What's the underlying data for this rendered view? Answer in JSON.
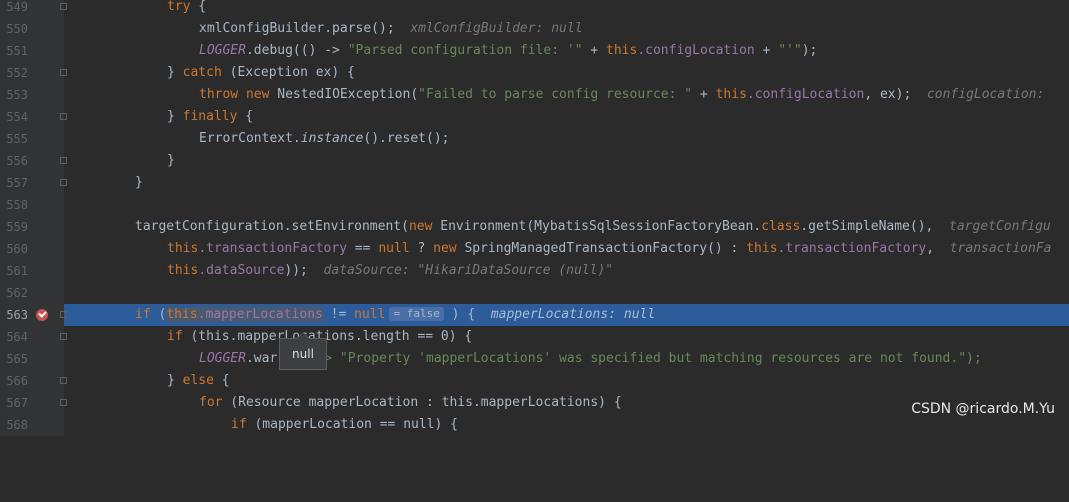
{
  "gutter": {
    "line_numbers": [
      "549",
      "550",
      "551",
      "552",
      "553",
      "554",
      "555",
      "556",
      "557",
      "558",
      "559",
      "560",
      "561",
      "562",
      "563",
      "564",
      "565",
      "566",
      "567",
      "568"
    ]
  },
  "code": {
    "l549": {
      "kw": "try",
      "rest": " {"
    },
    "l550": {
      "text": "xmlConfigBuilder.parse();",
      "hint": "xmlConfigBuilder: null"
    },
    "l551": {
      "obj": "LOGGER",
      "call": ".debug(() -> ",
      "s1": "\"Parsed configuration file: '\"",
      "plus": " + ",
      "this": "this",
      "fld": ".configLocation",
      "plus2": " + ",
      "s2": "\"'\"",
      "end": ");"
    },
    "l552": {
      "pre": "} ",
      "kw": "catch",
      "rest": " (Exception ex) {"
    },
    "l553": {
      "kw1": "throw",
      "kw2": "new",
      "cls": " NestedIOException(",
      "s1": "\"Failed to parse config resource: \"",
      "plus": " + ",
      "this": "this",
      "fld": ".configLocation",
      "rest": ", ex);",
      "hint": "configLocation: "
    },
    "l554": {
      "pre": "} ",
      "kw": "finally",
      "rest": " {"
    },
    "l555": {
      "cls": "ErrorContext.",
      "it": "instance",
      "rest": "().reset();"
    },
    "l556": {
      "text": "}"
    },
    "l557": {
      "text": "}"
    },
    "l559": {
      "pre": "targetConfiguration.setEnvironment(",
      "kw": "new",
      "cls": " Environment(MybatisSqlSessionFactoryBean.",
      "kw2": "class",
      "rest": ".getSimpleName(),",
      "hint": "targetConfigu"
    },
    "l560": {
      "this": "this",
      "fld": ".transactionFactory",
      "op": " == ",
      "kw": "null",
      "q": " ? ",
      "kw2": "new",
      "cls": " SpringManagedTransactionFactory() : ",
      "this2": "this",
      "fld2": ".transactionFactory",
      "rest": ",",
      "hint": "transactionFa"
    },
    "l561": {
      "this": "this",
      "fld": ".dataSource",
      "rest": "));",
      "hint": "dataSource: \"HikariDataSource (null)\""
    },
    "l563": {
      "kw": "if",
      "open": " (",
      "this": "this",
      "fld": ".mapperLocations",
      "op": " != ",
      "kw2": "null",
      "inlay": "= false",
      "rest": " ) {",
      "hint": "mapperLocations: null"
    },
    "l564": {
      "kw": "if",
      "rest": " (this.mapperLocations.length == 0) {"
    },
    "l565": {
      "obj": "LOGGER",
      "call": ".war",
      "rest": " > \"Property 'mapperLocations' was specified but matching resources are not found.\");"
    },
    "l566": {
      "pre": "} ",
      "kw": "else",
      "rest": " {"
    },
    "l567": {
      "kw": "for",
      "rest": " (Resource mapperLocation : this.mapperLocations) {"
    },
    "l568": {
      "kw": "if",
      "rest": " (mapperLocation == null) {"
    }
  },
  "tooltip": {
    "text": "null"
  },
  "watermark": {
    "text": "CSDN @ricardo.M.Yu"
  },
  "colors": {
    "background": "#2b2b2b",
    "gutter": "#313335",
    "execution_line": "#2d5c9a",
    "keyword": "#cc7832",
    "field": "#9876aa",
    "string": "#6a8759",
    "text": "#a9b7c6",
    "breakpoint": "#c75450"
  },
  "icons": {
    "breakpoint": "breakpoint-check-icon",
    "fold": "fold-marker-icon"
  }
}
